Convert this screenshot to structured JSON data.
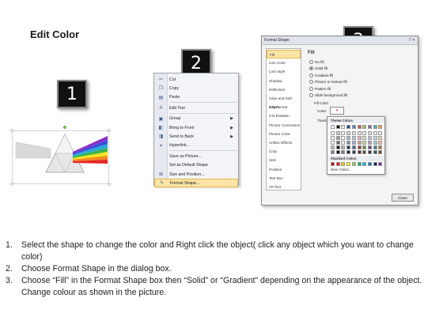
{
  "title": "Edit Color",
  "badges": [
    "1",
    "2",
    "3"
  ],
  "context_menu": {
    "items": [
      {
        "label": "Cut",
        "icon": "scissors-icon",
        "glyph": "✂",
        "sub": false
      },
      {
        "label": "Copy",
        "icon": "copy-icon",
        "glyph": "❐",
        "sub": false
      },
      {
        "label": "Paste",
        "icon": "paste-icon",
        "glyph": "▤",
        "sub": false
      },
      {
        "label": "Edit Text",
        "icon": "edit-text-icon",
        "glyph": "A",
        "sub": false
      },
      {
        "label": "Group",
        "icon": "group-icon",
        "glyph": "▣",
        "sub": true
      },
      {
        "label": "Bring to Front",
        "icon": "bring-front-icon",
        "glyph": "◧",
        "sub": true
      },
      {
        "label": "Send to Back",
        "icon": "send-back-icon",
        "glyph": "◨",
        "sub": true
      },
      {
        "label": "Hyperlink...",
        "icon": "hyperlink-icon",
        "glyph": "⚭",
        "sub": false
      },
      {
        "label": "Save as Picture...",
        "icon": "",
        "glyph": "",
        "sub": false
      },
      {
        "label": "Set as Default Shape",
        "icon": "",
        "glyph": "",
        "sub": false
      },
      {
        "label": "Size and Position...",
        "icon": "size-icon",
        "glyph": "⊞",
        "sub": false
      },
      {
        "label": "Format Shape...",
        "icon": "format-shape-icon",
        "glyph": "✎",
        "sub": false
      }
    ]
  },
  "dialog": {
    "title": "Format Shape",
    "controls": "? ✕",
    "nav": [
      "Fill",
      "Line Color",
      "Line Style",
      "Shadow",
      "Reflection",
      "Glow and Soft Edges",
      "3-D Format",
      "3-D Rotation",
      "Picture Corrections",
      "Picture Color",
      "Artistic Effects",
      "Crop",
      "Size",
      "Position",
      "Text Box",
      "Alt Text"
    ],
    "fill_heading": "Fill",
    "options": [
      "No fill",
      "Solid fill",
      "Gradient fill",
      "Picture or texture fill",
      "Pattern fill",
      "Slide background fill"
    ],
    "fill_color_label": "Fill Color",
    "color_label": "Color:",
    "color_btn": "▾",
    "transparency_label": "Transpa",
    "close_label": "Close"
  },
  "palette": {
    "theme_heading": "Theme Colors",
    "standard_heading": "Standard Colors",
    "more": "More Colors...",
    "theme_top": [
      "#ffffff",
      "#000000",
      "#eeece1",
      "#1f497d",
      "#4f81bd",
      "#c0504d",
      "#9bbb59",
      "#8064a2",
      "#4bacc6",
      "#f79646"
    ],
    "standard": [
      "#c00000",
      "#ff0000",
      "#ffc000",
      "#ffff00",
      "#92d050",
      "#00b050",
      "#00b0f0",
      "#0070c0",
      "#002060",
      "#7030a0"
    ]
  },
  "instructions": [
    {
      "num": "1.",
      "text": "Select the shape to change the color and Right click the object( click any object which you want to change color)"
    },
    {
      "num": "2.",
      "text": "Choose Format Shape in the dialog box."
    },
    {
      "num": "3.",
      "text": "Choose “Fill” in the Format Shape box then “Solid” or “Gradient” depending on the appearance of the object. Change colour as shown in the picture."
    }
  ]
}
